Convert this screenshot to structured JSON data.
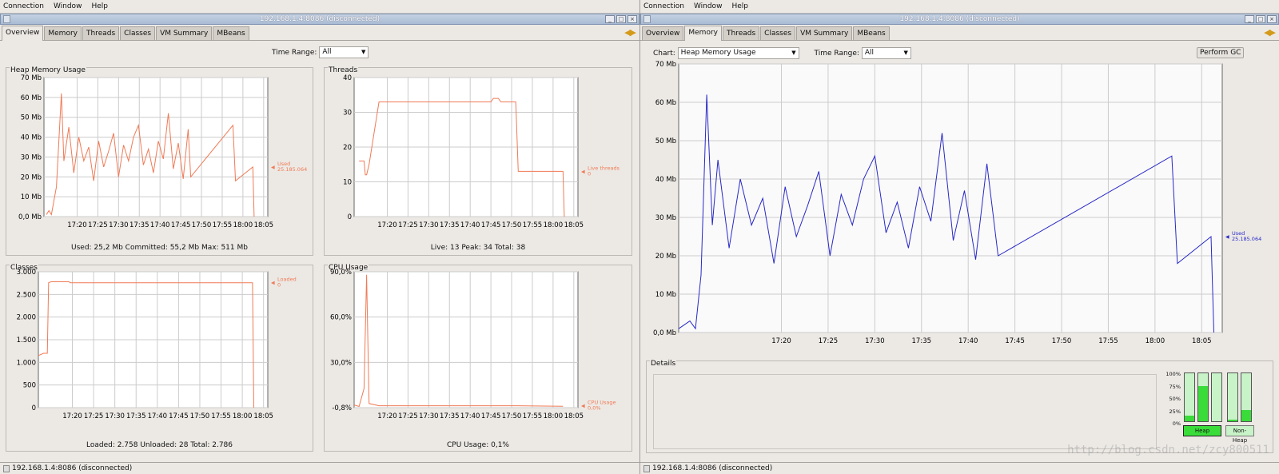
{
  "menu": [
    "Connection",
    "Window",
    "Help"
  ],
  "left": {
    "title": "192.168.1.4:8086 (disconnected)",
    "tabs": [
      "Overview",
      "Memory",
      "Threads",
      "Classes",
      "VM Summary",
      "MBeans"
    ],
    "time_range_label": "Time Range:",
    "time_range_value": "All",
    "status": "192.168.1.4:8086 (disconnected)"
  },
  "right": {
    "title": "192.168.1.4:8086 (disconnected)",
    "tabs": [
      "Overview",
      "Memory",
      "Threads",
      "Classes",
      "VM Summary",
      "MBeans"
    ],
    "chart_label": "Chart:",
    "chart_value": "Heap Memory Usage",
    "time_range_label": "Time Range:",
    "time_range_value": "All",
    "gc_button": "Perform GC",
    "details_label": "Details",
    "bar_pct": [
      "100%",
      "75%",
      "50%",
      "25%",
      "0%"
    ],
    "heap_label": "Heap",
    "nonheap_label": "Non-Heap",
    "status": "192.168.1.4:8086 (disconnected)"
  },
  "colors": {
    "orange": "#f07a55",
    "blue": "#2828c8",
    "green": "#3adc3a"
  },
  "watermark": "http://blog.csdn.net/zcy800511",
  "chart_data": [
    {
      "type": "line",
      "title": "Heap Memory Usage",
      "y_ticks": [
        "70 Mb",
        "60 Mb",
        "50 Mb",
        "40 Mb",
        "30 Mb",
        "20 Mb",
        "10 Mb",
        "0,0 Mb"
      ],
      "ylim": [
        0,
        70
      ],
      "x_ticks": [
        "17:20",
        "17:25",
        "17:30",
        "17:35",
        "17:40",
        "17:45",
        "17:50",
        "17:55",
        "18:00",
        "18:05"
      ],
      "xlim": [
        17.2,
        18.1
      ],
      "series": [
        {
          "name": "Used",
          "values": [
            [
              17.21,
              1
            ],
            [
              17.22,
              3
            ],
            [
              17.23,
              1
            ],
            [
              17.25,
              15
            ],
            [
              17.27,
              62
            ],
            [
              17.28,
              28
            ],
            [
              17.3,
              45
            ],
            [
              17.32,
              22
            ],
            [
              17.34,
              40
            ],
            [
              17.36,
              28
            ],
            [
              17.38,
              35
            ],
            [
              17.4,
              18
            ],
            [
              17.42,
              38
            ],
            [
              17.44,
              25
            ],
            [
              17.46,
              33
            ],
            [
              17.48,
              42
            ],
            [
              17.5,
              20
            ],
            [
              17.52,
              36
            ],
            [
              17.54,
              28
            ],
            [
              17.56,
              40
            ],
            [
              17.58,
              46
            ],
            [
              17.6,
              26
            ],
            [
              17.62,
              34
            ],
            [
              17.64,
              22
            ],
            [
              17.66,
              38
            ],
            [
              17.68,
              29
            ],
            [
              17.7,
              52
            ],
            [
              17.72,
              24
            ],
            [
              17.74,
              37
            ],
            [
              17.76,
              19
            ],
            [
              17.78,
              44
            ],
            [
              17.79,
              20
            ],
            [
              17.96,
              46
            ],
            [
              17.97,
              18
            ],
            [
              18.04,
              25
            ],
            [
              18.045,
              0
            ]
          ]
        }
      ],
      "annotation": [
        "Used",
        "25.185.064"
      ],
      "summary": "Used: 25,2 Mb    Committed: 55,2 Mb    Max: 511 Mb"
    },
    {
      "type": "line",
      "title": "Threads",
      "y_ticks": [
        "40",
        "30",
        "20",
        "10",
        "0"
      ],
      "ylim": [
        0,
        40
      ],
      "x_ticks": [
        "17:20",
        "17:25",
        "17:30",
        "17:35",
        "17:40",
        "17:45",
        "17:50",
        "17:55",
        "18:00",
        "18:05"
      ],
      "series": [
        {
          "name": "Live threads",
          "values": [
            [
              17.22,
              16
            ],
            [
              17.24,
              16
            ],
            [
              17.245,
              12
            ],
            [
              17.25,
              12
            ],
            [
              17.26,
              15
            ],
            [
              17.3,
              33
            ],
            [
              17.75,
              33
            ],
            [
              17.76,
              34
            ],
            [
              17.78,
              34
            ],
            [
              17.79,
              33
            ],
            [
              17.85,
              33
            ],
            [
              17.86,
              13
            ],
            [
              18.04,
              13
            ],
            [
              18.045,
              0
            ]
          ]
        }
      ],
      "annotation": [
        "Live threads",
        "0"
      ],
      "summary": "Live: 13    Peak: 34    Total: 38"
    },
    {
      "type": "line",
      "title": "Classes",
      "y_ticks": [
        "3.000",
        "2.500",
        "2.000",
        "1.500",
        "1.000",
        "500",
        "0"
      ],
      "ylim": [
        0,
        3000
      ],
      "x_ticks": [
        "17:20",
        "17:25",
        "17:30",
        "17:35",
        "17:40",
        "17:45",
        "17:50",
        "17:55",
        "18:00",
        "18:05"
      ],
      "series": [
        {
          "name": "Loaded",
          "values": [
            [
              17.2,
              1150
            ],
            [
              17.22,
              1200
            ],
            [
              17.235,
              1200
            ],
            [
              17.24,
              2758
            ],
            [
              17.25,
              2780
            ],
            [
              17.32,
              2780
            ],
            [
              17.325,
              2758
            ],
            [
              18.04,
              2758
            ],
            [
              18.045,
              0
            ]
          ]
        }
      ],
      "annotation": [
        "Loaded",
        "0"
      ],
      "summary": "Loaded: 2.758    Unloaded: 28    Total: 2.786"
    },
    {
      "type": "line",
      "title": "CPU Usage",
      "y_ticks": [
        "90,0%",
        "60,0%",
        "30,0%",
        "-0,8%"
      ],
      "ylim": [
        -0.8,
        90
      ],
      "x_ticks": [
        "17:20",
        "17:25",
        "17:30",
        "17:35",
        "17:40",
        "17:45",
        "17:50",
        "17:55",
        "18:00",
        "18:05"
      ],
      "series": [
        {
          "name": "CPU Usage",
          "values": [
            [
              17.2,
              1
            ],
            [
              17.22,
              0
            ],
            [
              17.24,
              12
            ],
            [
              17.25,
              88
            ],
            [
              17.26,
              2
            ],
            [
              17.3,
              0.5
            ],
            [
              17.85,
              0.5
            ],
            [
              18.04,
              0.1
            ]
          ]
        }
      ],
      "annotation": [
        "CPU Usage",
        "0,0%"
      ],
      "summary": "CPU Usage: 0,1%"
    },
    {
      "type": "line",
      "title": "Heap Memory Usage",
      "y_ticks": [
        "70 Mb",
        "60 Mb",
        "50 Mb",
        "40 Mb",
        "30 Mb",
        "20 Mb",
        "10 Mb",
        "0,0 Mb"
      ],
      "ylim": [
        0,
        70
      ],
      "x_ticks": [
        "17:20",
        "17:25",
        "17:30",
        "17:35",
        "17:40",
        "17:45",
        "17:50",
        "17:55",
        "18:00",
        "18:05"
      ],
      "series": [
        {
          "name": "Used",
          "values": [
            [
              17.15,
              1
            ],
            [
              17.17,
              3
            ],
            [
              17.18,
              1
            ],
            [
              17.19,
              15
            ],
            [
              17.2,
              62
            ],
            [
              17.21,
              28
            ],
            [
              17.22,
              45
            ],
            [
              17.24,
              22
            ],
            [
              17.26,
              40
            ],
            [
              17.28,
              28
            ],
            [
              17.3,
              35
            ],
            [
              17.32,
              18
            ],
            [
              17.34,
              38
            ],
            [
              17.36,
              25
            ],
            [
              17.38,
              33
            ],
            [
              17.4,
              42
            ],
            [
              17.42,
              20
            ],
            [
              17.44,
              36
            ],
            [
              17.46,
              28
            ],
            [
              17.48,
              40
            ],
            [
              17.5,
              46
            ],
            [
              17.52,
              26
            ],
            [
              17.54,
              34
            ],
            [
              17.56,
              22
            ],
            [
              17.58,
              38
            ],
            [
              17.6,
              29
            ],
            [
              17.62,
              52
            ],
            [
              17.64,
              24
            ],
            [
              17.66,
              37
            ],
            [
              17.68,
              19
            ],
            [
              17.7,
              44
            ],
            [
              17.72,
              20
            ],
            [
              18.03,
              46
            ],
            [
              18.04,
              18
            ],
            [
              18.1,
              25
            ],
            [
              18.105,
              0
            ]
          ]
        }
      ],
      "annotation": [
        "Used",
        "25.185.064"
      ]
    }
  ]
}
